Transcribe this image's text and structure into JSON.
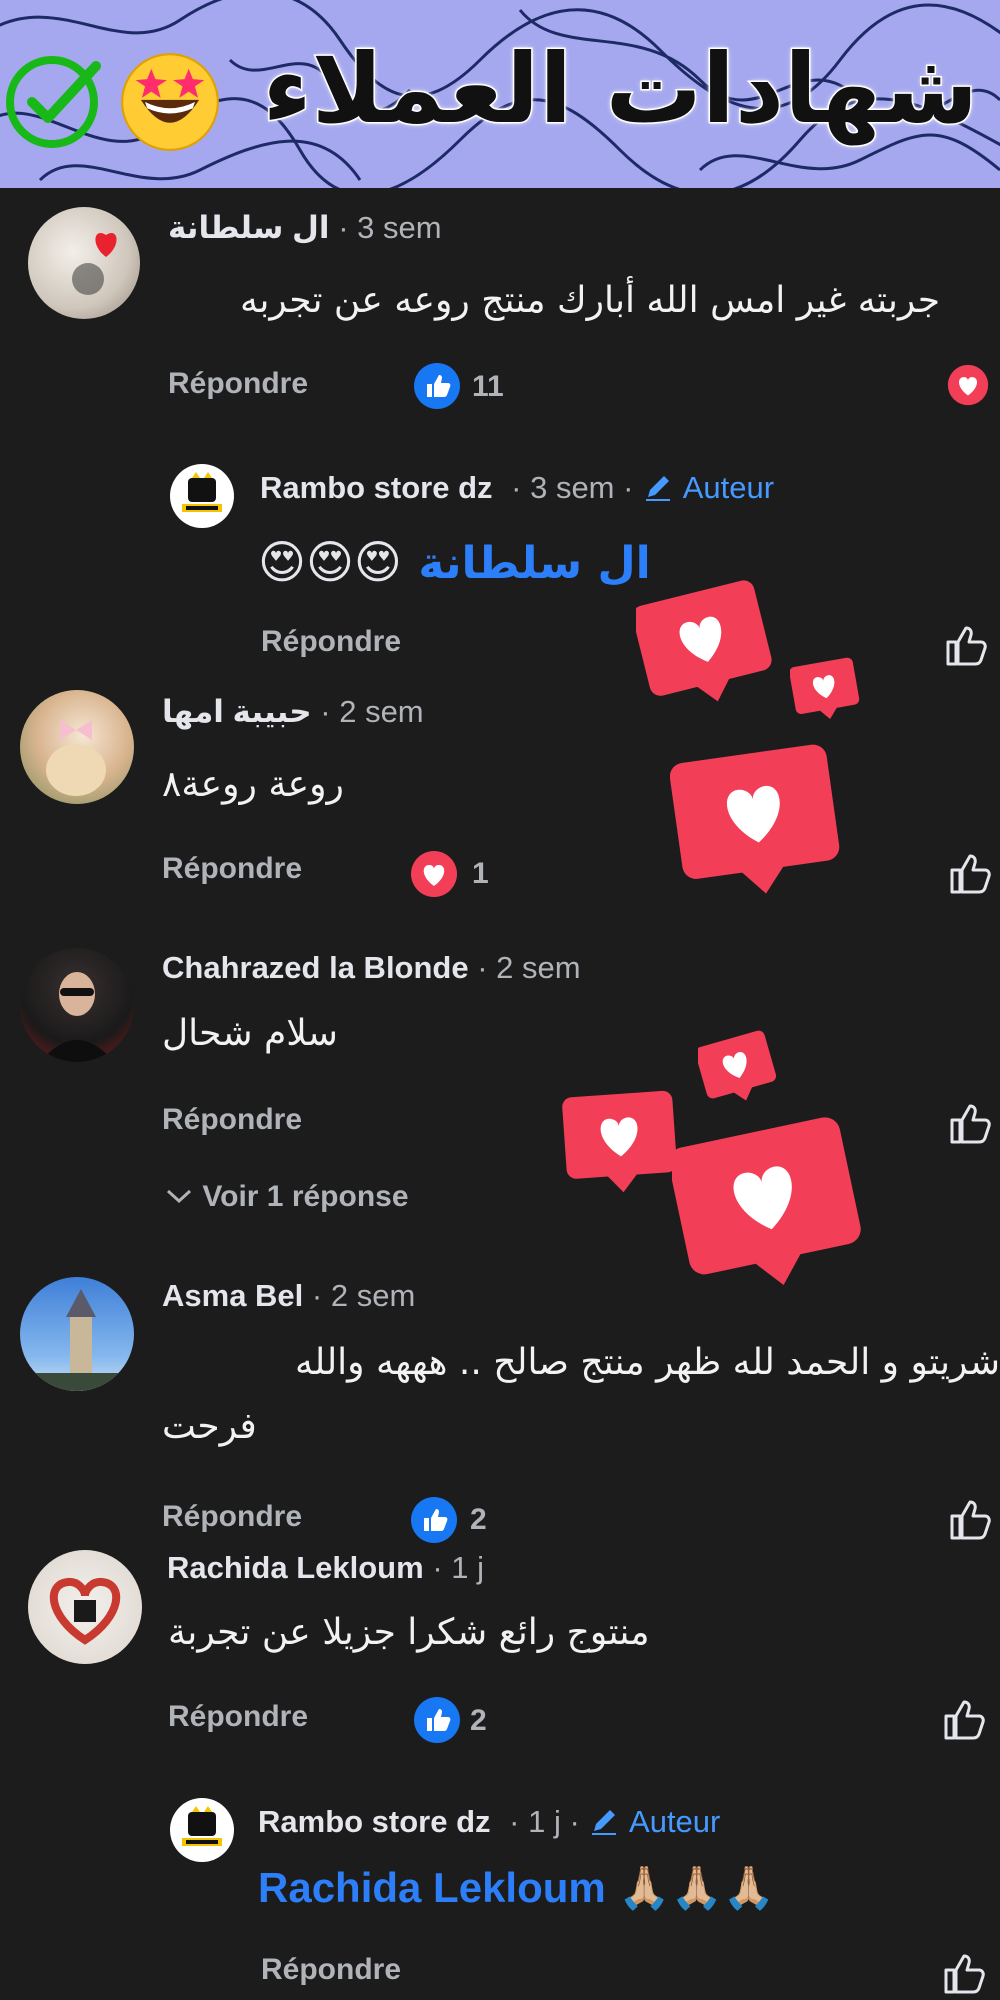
{
  "banner": {
    "title": "شهادات العملاء"
  },
  "comments": [
    {
      "name": "ال سلطانة",
      "time": "· 3 sem",
      "text": "جربته غير امس الله أبارك منتج روعه عن تجربه",
      "reply": "Répondre",
      "count": "11"
    },
    {
      "name": "Rambo store dz",
      "time": "· 3 sem ·",
      "author": "Auteur",
      "mention": "ال سلطانة",
      "emojis": "😍😍😍",
      "reply": "Répondre"
    },
    {
      "name": "حبيبة امها",
      "time": "· 2 sem",
      "text": "روعة روعة٨",
      "reply": "Répondre",
      "count": "1"
    },
    {
      "name": "Chahrazed la Blonde",
      "time": "· 2 sem",
      "text": "سلام شحال",
      "reply": "Répondre",
      "more": "Voir 1 réponse"
    },
    {
      "name": "Asma Bel",
      "time": "· 2 sem",
      "text_line1": "شريتو  و الحمد لله ظهر منتج صالح .. هههه    والله",
      "text_line2": "فرحت",
      "reply": "Répondre",
      "count": "2"
    },
    {
      "name": "Rachida Lekloum",
      "time": "· 1 j",
      "text": "منتوج رائع شكرا جزيلا عن تجربة",
      "reply": "Répondre",
      "count": "2"
    },
    {
      "name": "Rambo store dz",
      "time": "· 1 j ·",
      "author": "Auteur",
      "mention": "Rachida Lekloum",
      "emojis": "🙏🏼🙏🏼🙏🏼",
      "reply": "Répondre"
    }
  ],
  "colors": {
    "accent": "#2d7ff9",
    "like_blue": "#1877f2",
    "love_red": "#f33e58",
    "banner": "#a5a8ee",
    "bg": "#1c1c1d"
  }
}
